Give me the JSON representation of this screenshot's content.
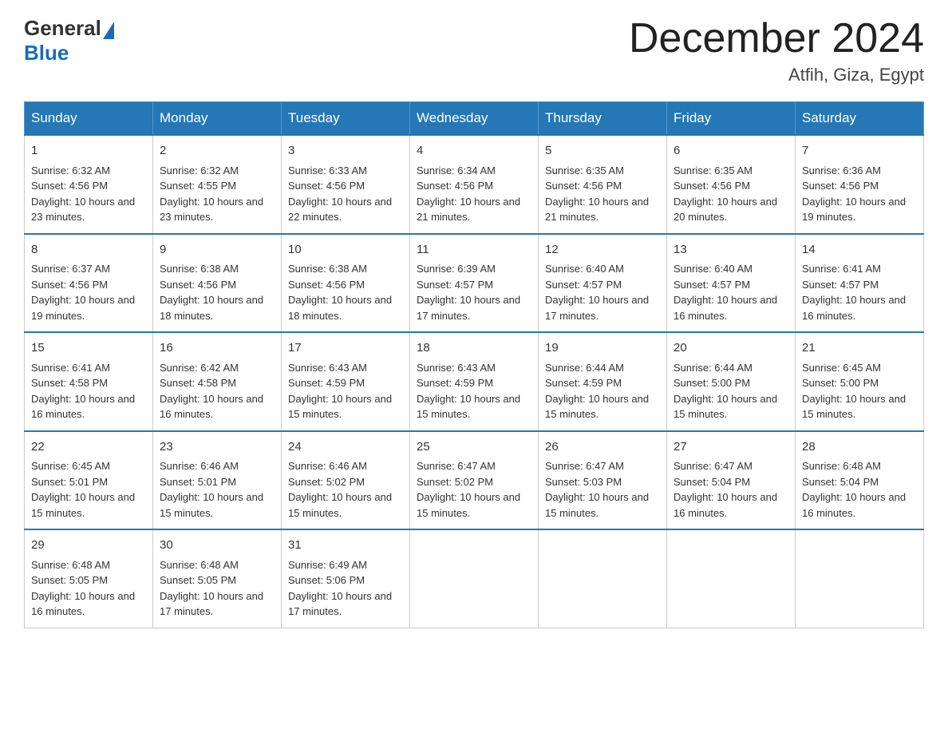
{
  "logo": {
    "general": "General",
    "blue": "Blue"
  },
  "title": "December 2024",
  "location": "Atfih, Giza, Egypt",
  "headers": [
    "Sunday",
    "Monday",
    "Tuesday",
    "Wednesday",
    "Thursday",
    "Friday",
    "Saturday"
  ],
  "weeks": [
    [
      {
        "day": "1",
        "sunrise": "6:32 AM",
        "sunset": "4:56 PM",
        "daylight": "10 hours and 23 minutes."
      },
      {
        "day": "2",
        "sunrise": "6:32 AM",
        "sunset": "4:55 PM",
        "daylight": "10 hours and 23 minutes."
      },
      {
        "day": "3",
        "sunrise": "6:33 AM",
        "sunset": "4:56 PM",
        "daylight": "10 hours and 22 minutes."
      },
      {
        "day": "4",
        "sunrise": "6:34 AM",
        "sunset": "4:56 PM",
        "daylight": "10 hours and 21 minutes."
      },
      {
        "day": "5",
        "sunrise": "6:35 AM",
        "sunset": "4:56 PM",
        "daylight": "10 hours and 21 minutes."
      },
      {
        "day": "6",
        "sunrise": "6:35 AM",
        "sunset": "4:56 PM",
        "daylight": "10 hours and 20 minutes."
      },
      {
        "day": "7",
        "sunrise": "6:36 AM",
        "sunset": "4:56 PM",
        "daylight": "10 hours and 19 minutes."
      }
    ],
    [
      {
        "day": "8",
        "sunrise": "6:37 AM",
        "sunset": "4:56 PM",
        "daylight": "10 hours and 19 minutes."
      },
      {
        "day": "9",
        "sunrise": "6:38 AM",
        "sunset": "4:56 PM",
        "daylight": "10 hours and 18 minutes."
      },
      {
        "day": "10",
        "sunrise": "6:38 AM",
        "sunset": "4:56 PM",
        "daylight": "10 hours and 18 minutes."
      },
      {
        "day": "11",
        "sunrise": "6:39 AM",
        "sunset": "4:57 PM",
        "daylight": "10 hours and 17 minutes."
      },
      {
        "day": "12",
        "sunrise": "6:40 AM",
        "sunset": "4:57 PM",
        "daylight": "10 hours and 17 minutes."
      },
      {
        "day": "13",
        "sunrise": "6:40 AM",
        "sunset": "4:57 PM",
        "daylight": "10 hours and 16 minutes."
      },
      {
        "day": "14",
        "sunrise": "6:41 AM",
        "sunset": "4:57 PM",
        "daylight": "10 hours and 16 minutes."
      }
    ],
    [
      {
        "day": "15",
        "sunrise": "6:41 AM",
        "sunset": "4:58 PM",
        "daylight": "10 hours and 16 minutes."
      },
      {
        "day": "16",
        "sunrise": "6:42 AM",
        "sunset": "4:58 PM",
        "daylight": "10 hours and 16 minutes."
      },
      {
        "day": "17",
        "sunrise": "6:43 AM",
        "sunset": "4:59 PM",
        "daylight": "10 hours and 15 minutes."
      },
      {
        "day": "18",
        "sunrise": "6:43 AM",
        "sunset": "4:59 PM",
        "daylight": "10 hours and 15 minutes."
      },
      {
        "day": "19",
        "sunrise": "6:44 AM",
        "sunset": "4:59 PM",
        "daylight": "10 hours and 15 minutes."
      },
      {
        "day": "20",
        "sunrise": "6:44 AM",
        "sunset": "5:00 PM",
        "daylight": "10 hours and 15 minutes."
      },
      {
        "day": "21",
        "sunrise": "6:45 AM",
        "sunset": "5:00 PM",
        "daylight": "10 hours and 15 minutes."
      }
    ],
    [
      {
        "day": "22",
        "sunrise": "6:45 AM",
        "sunset": "5:01 PM",
        "daylight": "10 hours and 15 minutes."
      },
      {
        "day": "23",
        "sunrise": "6:46 AM",
        "sunset": "5:01 PM",
        "daylight": "10 hours and 15 minutes."
      },
      {
        "day": "24",
        "sunrise": "6:46 AM",
        "sunset": "5:02 PM",
        "daylight": "10 hours and 15 minutes."
      },
      {
        "day": "25",
        "sunrise": "6:47 AM",
        "sunset": "5:02 PM",
        "daylight": "10 hours and 15 minutes."
      },
      {
        "day": "26",
        "sunrise": "6:47 AM",
        "sunset": "5:03 PM",
        "daylight": "10 hours and 15 minutes."
      },
      {
        "day": "27",
        "sunrise": "6:47 AM",
        "sunset": "5:04 PM",
        "daylight": "10 hours and 16 minutes."
      },
      {
        "day": "28",
        "sunrise": "6:48 AM",
        "sunset": "5:04 PM",
        "daylight": "10 hours and 16 minutes."
      }
    ],
    [
      {
        "day": "29",
        "sunrise": "6:48 AM",
        "sunset": "5:05 PM",
        "daylight": "10 hours and 16 minutes."
      },
      {
        "day": "30",
        "sunrise": "6:48 AM",
        "sunset": "5:05 PM",
        "daylight": "10 hours and 17 minutes."
      },
      {
        "day": "31",
        "sunrise": "6:49 AM",
        "sunset": "5:06 PM",
        "daylight": "10 hours and 17 minutes."
      },
      null,
      null,
      null,
      null
    ]
  ]
}
